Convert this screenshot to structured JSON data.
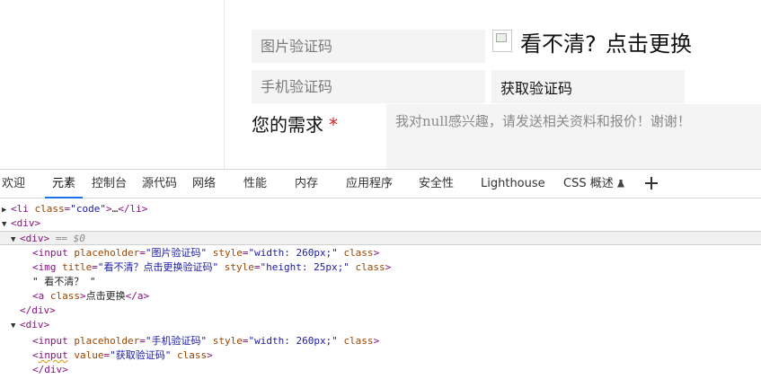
{
  "form": {
    "image_code_placeholder": "图片验证码",
    "cant_see": "看不清?",
    "refresh": "点击更换",
    "phone_code_placeholder": "手机验证码",
    "get_code": "获取验证码",
    "need_label": "您的需求",
    "required_mark": "*",
    "need_placeholder": "我对null感兴趣，请发送相关资料和报价！谢谢！"
  },
  "devtools": {
    "tabs": [
      "欢迎",
      "元素",
      "控制台",
      "源代码",
      "网络",
      "性能",
      "内存",
      "应用程序",
      "安全性",
      "Lighthouse",
      "CSS 概述"
    ],
    "active_tab": "元素"
  },
  "tree": {
    "l1_class_val": "\"code\"",
    "l1_ellipsis": "…",
    "sel_marker": "== $0",
    "img_placeholder_val": "\"图片验证码\"",
    "style_w260": "\"width: 260px;\"",
    "img_title_val": "\"看不清？点击更换验证码\"",
    "img_style_val": "\"height: 25px;\"",
    "text_node": "\" 看不清？ \"",
    "a_text": "点击更换",
    "phone_placeholder_val": "\"手机验证码\"",
    "btn_value_val": "\"获取验证码\""
  }
}
